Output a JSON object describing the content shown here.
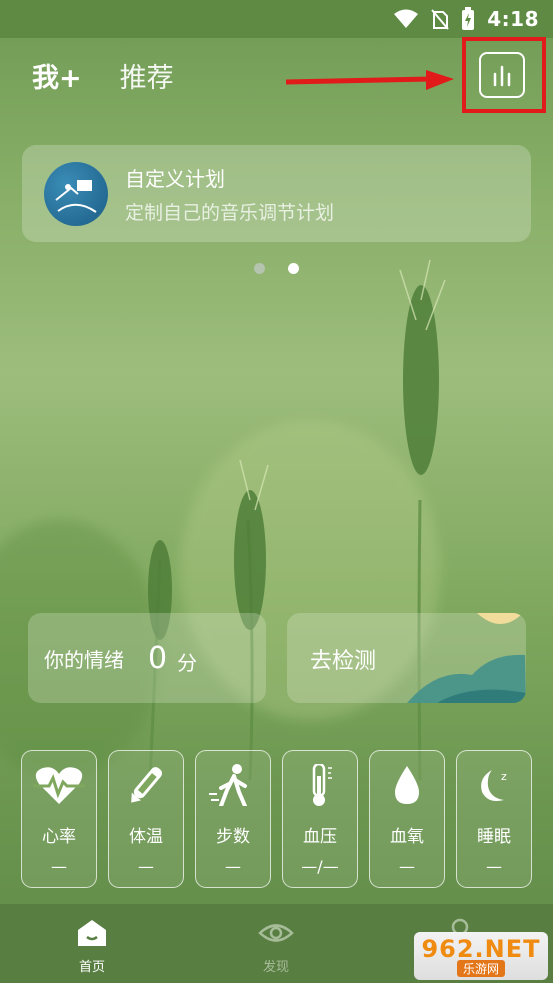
{
  "status_bar": {
    "time": "4:18",
    "icons": [
      "wifi-icon",
      "no-sim-icon",
      "battery-charging-icon"
    ]
  },
  "top_tabs": [
    {
      "label": "我+"
    },
    {
      "label": "推荐"
    }
  ],
  "toolbar": {
    "stats_icon": "bar-chart-icon"
  },
  "banner": {
    "title": "自定义计划",
    "subtitle": "定制自己的音乐调节计划",
    "icon": "custom-plan-icon"
  },
  "carousel": {
    "page_count": 2,
    "active_index": 1
  },
  "mood": {
    "label": "你的情绪",
    "value": "0",
    "unit": "分"
  },
  "detect": {
    "label": "去检测"
  },
  "metrics": [
    {
      "name": "心率",
      "value": "—",
      "icon": "heart-rate-icon"
    },
    {
      "name": "体温",
      "value": "—",
      "icon": "thermometer-icon"
    },
    {
      "name": "步数",
      "value": "—",
      "icon": "walking-icon"
    },
    {
      "name": "血压",
      "value": "—/—",
      "icon": "blood-pressure-icon"
    },
    {
      "name": "血氧",
      "value": "—",
      "icon": "blood-drop-icon"
    },
    {
      "name": "睡眠",
      "value": "—",
      "icon": "moon-icon"
    }
  ],
  "bottom_nav": [
    {
      "label": "首页",
      "icon": "home-icon"
    },
    {
      "label": "发现",
      "icon": "eye-icon"
    },
    {
      "label": "",
      "icon": "profile-icon"
    }
  ],
  "watermark": {
    "top": "962.NET",
    "bottom": "乐游网"
  },
  "colors": {
    "accent_red": "#e11a1a",
    "status_bar": "#5e8a44",
    "nav_bar": "#597e42"
  }
}
